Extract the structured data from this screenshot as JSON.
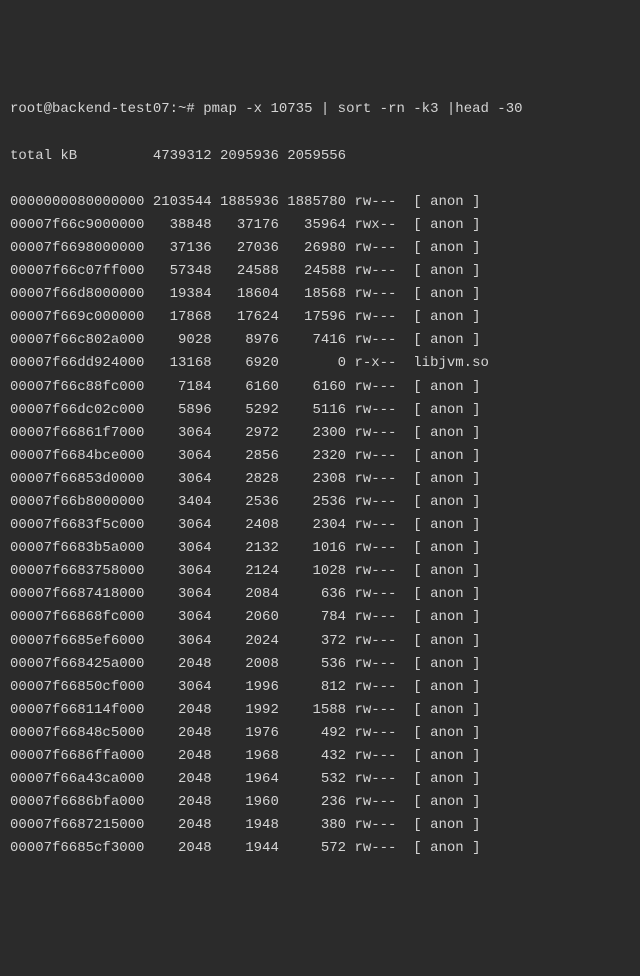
{
  "prompt": "root@backend-test07:~#",
  "command": "pmap -x 10735 | sort -rn -k3 |head -30",
  "total_label": "total kB",
  "total": {
    "kbytes": "4739312",
    "rss": "2095936",
    "dirty": "2059556"
  },
  "rows": [
    {
      "addr": "0000000080000000",
      "kb": "2103544",
      "rss": "1885936",
      "dirty": "1885780",
      "mode": "rw---",
      "map": "[ anon ]"
    },
    {
      "addr": "00007f66c9000000",
      "kb": "38848",
      "rss": "37176",
      "dirty": "35964",
      "mode": "rwx--",
      "map": "[ anon ]"
    },
    {
      "addr": "00007f6698000000",
      "kb": "37136",
      "rss": "27036",
      "dirty": "26980",
      "mode": "rw---",
      "map": "[ anon ]"
    },
    {
      "addr": "00007f66c07ff000",
      "kb": "57348",
      "rss": "24588",
      "dirty": "24588",
      "mode": "rw---",
      "map": "[ anon ]"
    },
    {
      "addr": "00007f66d8000000",
      "kb": "19384",
      "rss": "18604",
      "dirty": "18568",
      "mode": "rw---",
      "map": "[ anon ]"
    },
    {
      "addr": "00007f669c000000",
      "kb": "17868",
      "rss": "17624",
      "dirty": "17596",
      "mode": "rw---",
      "map": "[ anon ]"
    },
    {
      "addr": "00007f66c802a000",
      "kb": "9028",
      "rss": "8976",
      "dirty": "7416",
      "mode": "rw---",
      "map": "[ anon ]"
    },
    {
      "addr": "00007f66dd924000",
      "kb": "13168",
      "rss": "6920",
      "dirty": "0",
      "mode": "r-x--",
      "map": "libjvm.so"
    },
    {
      "addr": "00007f66c88fc000",
      "kb": "7184",
      "rss": "6160",
      "dirty": "6160",
      "mode": "rw---",
      "map": "[ anon ]"
    },
    {
      "addr": "00007f66dc02c000",
      "kb": "5896",
      "rss": "5292",
      "dirty": "5116",
      "mode": "rw---",
      "map": "[ anon ]"
    },
    {
      "addr": "00007f66861f7000",
      "kb": "3064",
      "rss": "2972",
      "dirty": "2300",
      "mode": "rw---",
      "map": "[ anon ]"
    },
    {
      "addr": "00007f6684bce000",
      "kb": "3064",
      "rss": "2856",
      "dirty": "2320",
      "mode": "rw---",
      "map": "[ anon ]"
    },
    {
      "addr": "00007f66853d0000",
      "kb": "3064",
      "rss": "2828",
      "dirty": "2308",
      "mode": "rw---",
      "map": "[ anon ]"
    },
    {
      "addr": "00007f66b8000000",
      "kb": "3404",
      "rss": "2536",
      "dirty": "2536",
      "mode": "rw---",
      "map": "[ anon ]"
    },
    {
      "addr": "00007f6683f5c000",
      "kb": "3064",
      "rss": "2408",
      "dirty": "2304",
      "mode": "rw---",
      "map": "[ anon ]"
    },
    {
      "addr": "00007f6683b5a000",
      "kb": "3064",
      "rss": "2132",
      "dirty": "1016",
      "mode": "rw---",
      "map": "[ anon ]"
    },
    {
      "addr": "00007f6683758000",
      "kb": "3064",
      "rss": "2124",
      "dirty": "1028",
      "mode": "rw---",
      "map": "[ anon ]"
    },
    {
      "addr": "00007f6687418000",
      "kb": "3064",
      "rss": "2084",
      "dirty": "636",
      "mode": "rw---",
      "map": "[ anon ]"
    },
    {
      "addr": "00007f66868fc000",
      "kb": "3064",
      "rss": "2060",
      "dirty": "784",
      "mode": "rw---",
      "map": "[ anon ]"
    },
    {
      "addr": "00007f6685ef6000",
      "kb": "3064",
      "rss": "2024",
      "dirty": "372",
      "mode": "rw---",
      "map": "[ anon ]"
    },
    {
      "addr": "00007f668425a000",
      "kb": "2048",
      "rss": "2008",
      "dirty": "536",
      "mode": "rw---",
      "map": "[ anon ]"
    },
    {
      "addr": "00007f66850cf000",
      "kb": "3064",
      "rss": "1996",
      "dirty": "812",
      "mode": "rw---",
      "map": "[ anon ]"
    },
    {
      "addr": "00007f668114f000",
      "kb": "2048",
      "rss": "1992",
      "dirty": "1588",
      "mode": "rw---",
      "map": "[ anon ]"
    },
    {
      "addr": "00007f66848c5000",
      "kb": "2048",
      "rss": "1976",
      "dirty": "492",
      "mode": "rw---",
      "map": "[ anon ]"
    },
    {
      "addr": "00007f6686ffa000",
      "kb": "2048",
      "rss": "1968",
      "dirty": "432",
      "mode": "rw---",
      "map": "[ anon ]"
    },
    {
      "addr": "00007f66a43ca000",
      "kb": "2048",
      "rss": "1964",
      "dirty": "532",
      "mode": "rw---",
      "map": "[ anon ]"
    },
    {
      "addr": "00007f6686bfa000",
      "kb": "2048",
      "rss": "1960",
      "dirty": "236",
      "mode": "rw---",
      "map": "[ anon ]"
    },
    {
      "addr": "00007f6687215000",
      "kb": "2048",
      "rss": "1948",
      "dirty": "380",
      "mode": "rw---",
      "map": "[ anon ]"
    },
    {
      "addr": "00007f6685cf3000",
      "kb": "2048",
      "rss": "1944",
      "dirty": "572",
      "mode": "rw---",
      "map": "[ anon ]"
    }
  ]
}
